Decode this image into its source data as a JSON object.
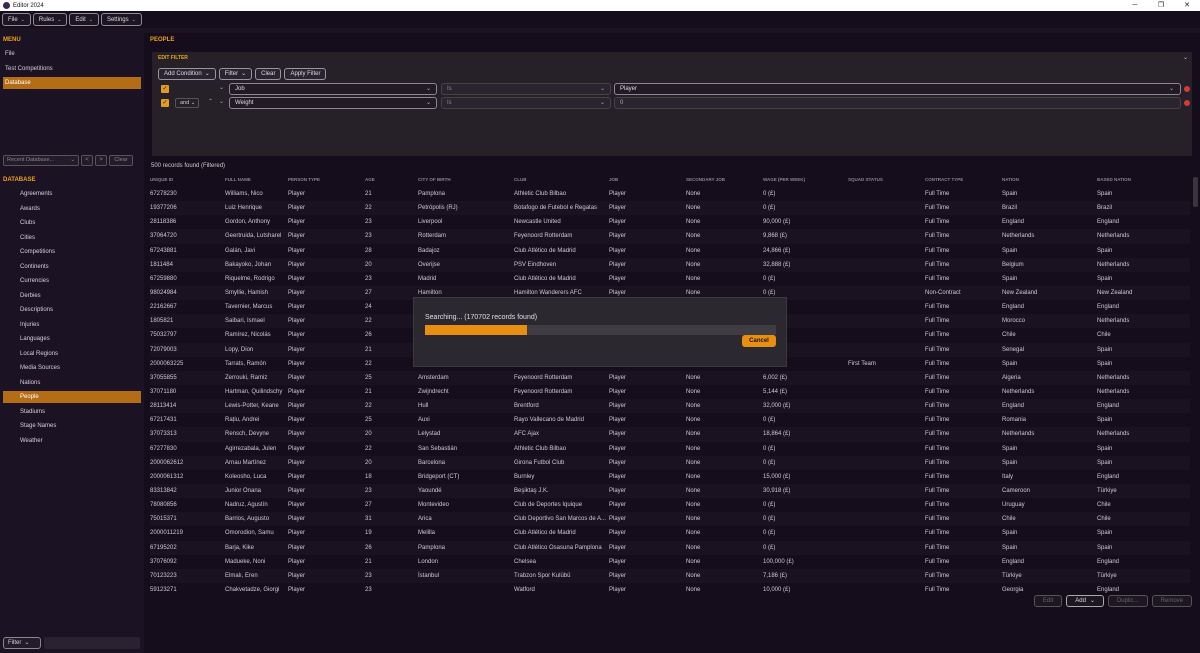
{
  "window": {
    "title": "Editor 2024"
  },
  "menubar": [
    "File",
    "Rules",
    "Edit",
    "Settings"
  ],
  "left_menu": {
    "heading": "MENU",
    "items": [
      "File",
      "Test Competitions",
      "Database"
    ]
  },
  "recent_db": {
    "placeholder": "Recent Database...",
    "prev": "<",
    "next": ">",
    "clear": "Clear"
  },
  "database_section": {
    "heading": "DATABASE",
    "items": [
      "Agreements",
      "Awards",
      "Clubs",
      "Cities",
      "Competitions",
      "Continents",
      "Currencies",
      "Derbies",
      "Descriptions",
      "Injuries",
      "Languages",
      "Local Regions",
      "Media Sources",
      "Nations",
      "People",
      "Stadiums",
      "Stage Names",
      "Weather"
    ],
    "selected": "People"
  },
  "filter_footer": {
    "label": "Filter"
  },
  "page_title": "PEOPLE",
  "edit_filter": {
    "title": "EDIT FILTER",
    "buttons": {
      "add_condition": "Add Condition",
      "filter": "Filter",
      "clear": "Clear",
      "apply": "Apply Filter"
    },
    "conditions": [
      {
        "connector": "",
        "field": "Job",
        "operator": "Is",
        "value": "Player"
      },
      {
        "connector": "and",
        "field": "Weight",
        "operator": "Is",
        "value": "0"
      }
    ]
  },
  "records_found": "500 records found (Filtered)",
  "columns": [
    "UNIQUE ID",
    "FULL NAME",
    "PERSON TYPE",
    "AGE",
    "CITY OF BIRTH",
    "CLUB",
    "JOB",
    "SECONDARY JOB",
    "WAGE (PER WEEK)",
    "SQUAD STATUS",
    "CONTRACT TYPE",
    "NATION",
    "BASED NATION"
  ],
  "rows": [
    [
      "67278230",
      "Williams, Nico",
      "Player",
      "21",
      "Pamplona",
      "Athletic Club Bilbao",
      "Player",
      "None",
      "0 (£)",
      "",
      "Full Time",
      "Spain",
      "Spain"
    ],
    [
      "19377206",
      "Luiz Henrique",
      "Player",
      "22",
      "Petrópolis (RJ)",
      "Botafogo de Futebol e Regatas",
      "Player",
      "None",
      "0 (£)",
      "",
      "Full Time",
      "Brazil",
      "Brazil"
    ],
    [
      "28118386",
      "Gordon, Anthony",
      "Player",
      "23",
      "Liverpool",
      "Newcastle United",
      "Player",
      "None",
      "90,000 (£)",
      "",
      "Full Time",
      "England",
      "England"
    ],
    [
      "37064720",
      "Geertruida, Lutsharel",
      "Player",
      "23",
      "Rotterdam",
      "Feyenoord Rotterdam",
      "Player",
      "None",
      "9,868 (£)",
      "",
      "Full Time",
      "Netherlands",
      "Netherlands"
    ],
    [
      "67243881",
      "Galán, Javi",
      "Player",
      "28",
      "Badajoz",
      "Club Atlético de Madrid",
      "Player",
      "None",
      "24,866 (£)",
      "",
      "Full Time",
      "Spain",
      "Spain"
    ],
    [
      "1811484",
      "Bakayoko, Johan",
      "Player",
      "20",
      "Overijse",
      "PSV Eindhoven",
      "Player",
      "None",
      "32,888 (£)",
      "",
      "Full Time",
      "Belgium",
      "Netherlands"
    ],
    [
      "67259880",
      "Riquelme, Rodrigo",
      "Player",
      "23",
      "Madrid",
      "Club Atlético de Madrid",
      "Player",
      "None",
      "0 (£)",
      "",
      "Full Time",
      "Spain",
      "Spain"
    ],
    [
      "98024984",
      "Smyllie, Hamish",
      "Player",
      "27",
      "Hamilton",
      "Hamilton Wanderers AFC",
      "Player",
      "None",
      "0 (£)",
      "",
      "Non-Contract",
      "New Zealand",
      "New Zealand"
    ],
    [
      "22162667",
      "Tavernier, Marcus",
      "Player",
      "24",
      "",
      "",
      "",
      "",
      "",
      "",
      "Full Time",
      "England",
      "England"
    ],
    [
      "1805821",
      "Saibari, Ismael",
      "Player",
      "22",
      "",
      "",
      "",
      "",
      "",
      "",
      "Full Time",
      "Morocco",
      "Netherlands"
    ],
    [
      "75032797",
      "Ramírez, Nicolás",
      "Player",
      "26",
      "",
      "",
      "",
      "",
      "",
      "",
      "Full Time",
      "Chile",
      "Chile"
    ],
    [
      "72079003",
      "Lopy, Dion",
      "Player",
      "21",
      "",
      "",
      "",
      "",
      "",
      "",
      "Full Time",
      "Senegal",
      "Spain"
    ],
    [
      "2000063225",
      "Tarrats, Ramón",
      "Player",
      "22",
      "",
      "",
      "",
      "",
      "",
      "First Team",
      "Full Time",
      "Spain",
      "Spain"
    ],
    [
      "37055855",
      "Zerrouki, Ramiz",
      "Player",
      "25",
      "Amsterdam",
      "Feyenoord Rotterdam",
      "Player",
      "None",
      "6,002 (£)",
      "",
      "Full Time",
      "Algeria",
      "Netherlands"
    ],
    [
      "37071180",
      "Hartman, Quilindschy",
      "Player",
      "21",
      "Zwijndrecht",
      "Feyenoord Rotterdam",
      "Player",
      "None",
      "5,144 (£)",
      "",
      "Full Time",
      "Netherlands",
      "Netherlands"
    ],
    [
      "28113414",
      "Lewis-Potter, Keane",
      "Player",
      "22",
      "Hull",
      "Brentford",
      "Player",
      "None",
      "32,000 (£)",
      "",
      "Full Time",
      "England",
      "England"
    ],
    [
      "67217431",
      "Rațiu, Andrei",
      "Player",
      "25",
      "Auxi",
      "Rayo Vallecano de Madrid",
      "Player",
      "None",
      "0 (£)",
      "",
      "Full Time",
      "Romania",
      "Spain"
    ],
    [
      "37073313",
      "Rensch, Devyne",
      "Player",
      "20",
      "Lelystad",
      "AFC Ajax",
      "Player",
      "None",
      "18,864 (£)",
      "",
      "Full Time",
      "Netherlands",
      "Netherlands"
    ],
    [
      "67277830",
      "Agirrezabala, Julen",
      "Player",
      "22",
      "San Sebastián",
      "Athletic Club Bilbao",
      "Player",
      "None",
      "0 (£)",
      "",
      "Full Time",
      "Spain",
      "Spain"
    ],
    [
      "2000062612",
      "Arnau Martínez",
      "Player",
      "20",
      "Barcelona",
      "Girona Futbol Club",
      "Player",
      "None",
      "0 (£)",
      "",
      "Full Time",
      "Spain",
      "Spain"
    ],
    [
      "2000061312",
      "Koleosho, Luca",
      "Player",
      "18",
      "Bridgeport (CT)",
      "Burnley",
      "Player",
      "None",
      "15,000 (£)",
      "",
      "Full Time",
      "Italy",
      "England"
    ],
    [
      "83313842",
      "Junior Onana",
      "Player",
      "23",
      "Yaoundé",
      "Beşiktaş J.K.",
      "Player",
      "None",
      "30,918 (£)",
      "",
      "Full Time",
      "Cameroon",
      "Türkiye"
    ],
    [
      "78080856",
      "Nadruz, Agustín",
      "Player",
      "27",
      "Montevideo",
      "Club de Deportes Iquique",
      "Player",
      "None",
      "0 (£)",
      "",
      "Full Time",
      "Uruguay",
      "Chile"
    ],
    [
      "75015371",
      "Barrios, Augusto",
      "Player",
      "31",
      "Arica",
      "Club Deportivo San Marcos de A...",
      "Player",
      "None",
      "0 (£)",
      "",
      "Full Time",
      "Chile",
      "Chile"
    ],
    [
      "2000011219",
      "Omorodion, Samu",
      "Player",
      "19",
      "Melilla",
      "Club Atlético de Madrid",
      "Player",
      "None",
      "0 (£)",
      "",
      "Full Time",
      "Spain",
      "Spain"
    ],
    [
      "67195202",
      "Barja, Kike",
      "Player",
      "26",
      "Pamplona",
      "Club Atlético Osasuna Pamplona",
      "Player",
      "None",
      "0 (£)",
      "",
      "Full Time",
      "Spain",
      "Spain"
    ],
    [
      "37076092",
      "Madueke, Noni",
      "Player",
      "21",
      "London",
      "Chelsea",
      "Player",
      "None",
      "100,000 (£)",
      "",
      "Full Time",
      "England",
      "England"
    ],
    [
      "70123223",
      "Elmalı, Eren",
      "Player",
      "23",
      "İstanbul",
      "Trabzon Spor Kulübü",
      "Player",
      "None",
      "7,186 (£)",
      "",
      "Full Time",
      "Türkiye",
      "Türkiye"
    ],
    [
      "59123271",
      "Chakvetadze, Giorgi",
      "Player",
      "23",
      "",
      "Watford",
      "Player",
      "None",
      "10,000 (£)",
      "",
      "Full Time",
      "Georgia",
      "England"
    ]
  ],
  "bottom_buttons": {
    "edit": "Edit",
    "add": "Add",
    "duplicate": "Duplic...",
    "remove": "Remove"
  },
  "search_overlay": {
    "text": "Searching... (170702 records found)",
    "progress": 0.29,
    "cancel": "Cancel"
  }
}
